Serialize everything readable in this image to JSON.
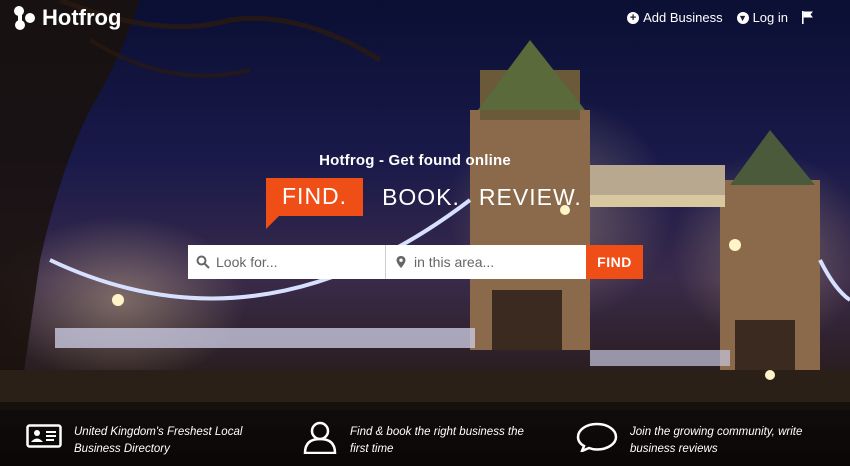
{
  "brand": {
    "name": "Hotfrog"
  },
  "nav": {
    "add_business": "Add Business",
    "login": "Log in"
  },
  "hero": {
    "tagline": "Hotfrog - Get found online",
    "find": "FIND.",
    "book": "BOOK.",
    "review": "REVIEW."
  },
  "search": {
    "what_placeholder": "Look for...",
    "where_placeholder": "in this area...",
    "button": "FIND"
  },
  "features": [
    {
      "icon": "contact-card-icon",
      "text": "United Kingdom's Freshest Local Business Directory"
    },
    {
      "icon": "person-icon",
      "text": "Find & book the right business the first time"
    },
    {
      "icon": "speech-bubble-icon",
      "text": "Join the growing community, write business reviews"
    }
  ],
  "colors": {
    "accent": "#ef4f17"
  }
}
